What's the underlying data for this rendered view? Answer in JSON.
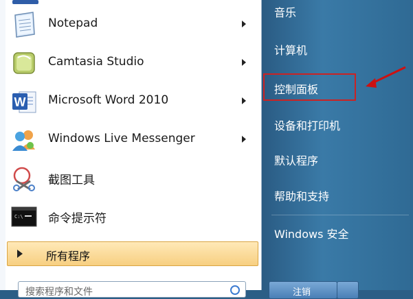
{
  "left_menu": {
    "items": [
      {
        "label": "Notepad",
        "icon": "notepad-icon",
        "has_submenu": true
      },
      {
        "label": "Camtasia Studio",
        "icon": "camtasia-icon",
        "has_submenu": true
      },
      {
        "label": "Microsoft Word 2010",
        "icon": "word-icon",
        "has_submenu": true
      },
      {
        "label": "Windows Live Messenger",
        "icon": "messenger-icon",
        "has_submenu": true
      },
      {
        "label": "截图工具",
        "icon": "snipping-tool-icon",
        "has_submenu": false
      },
      {
        "label": "命令提示符",
        "icon": "command-prompt-icon",
        "has_submenu": false
      }
    ],
    "all_programs": "所有程序",
    "search_placeholder": "搜索程序和文件"
  },
  "right_menu": {
    "items": [
      "音乐",
      "计算机",
      "控制面板",
      "设备和打印机",
      "默认程序",
      "帮助和支持",
      "Windows 安全"
    ],
    "highlighted": "控制面板",
    "shutdown_label": "注销"
  },
  "colors": {
    "highlight_border": "#cc2222",
    "annotation_arrow": "#cc1111",
    "right_pane": "#3a7aa7",
    "all_programs_bg": "#f7cf81"
  }
}
